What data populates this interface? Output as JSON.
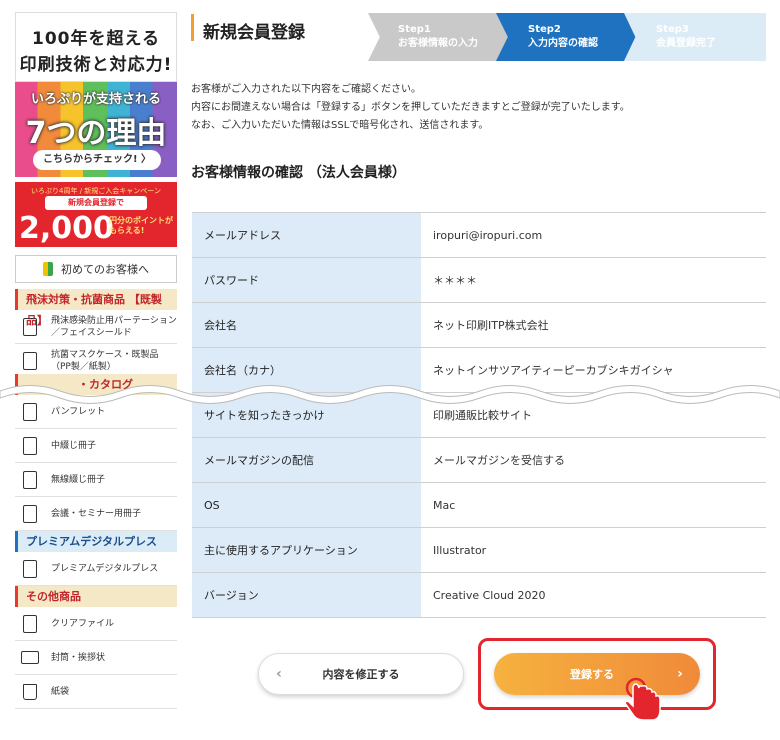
{
  "sidebar": {
    "banner1": {
      "line1": "100年を超える",
      "line2": "印刷技術と対応力!",
      "line3": "いろぷりが支持される",
      "line4": "7つの理由",
      "cta": "こちらからチェック! 〉"
    },
    "banner2": {
      "top": "いろぷり4周年 / 新規ご入会キャンペーン",
      "pill": "新規会員登録で",
      "amount": "2,000",
      "suffix": "円分のポイントがもらえる!"
    },
    "first_visit": "初めてのお客様へ",
    "sections": [
      {
        "heading": "飛沫対策・抗菌商品 【既製品】",
        "items": [
          "飛沫感染防止用パーテーション／フェイスシールド",
          "抗菌マスクケース・既製品（PP製／紙製）"
        ]
      },
      {
        "heading": "・カタログ",
        "items": [
          "パンフレット",
          "中綴じ冊子",
          "無線綴じ冊子",
          "会議・セミナー用冊子"
        ]
      },
      {
        "heading": "プレミアムデジタルプレス",
        "items": [
          "プレミアムデジタルプレス"
        ]
      },
      {
        "heading": "その他商品",
        "items": [
          "クリアファイル",
          "封筒・挨拶状",
          "紙袋"
        ]
      }
    ]
  },
  "page": {
    "title": "新規会員登録",
    "steps": [
      {
        "num": "Step1",
        "label": "お客様情報の入力"
      },
      {
        "num": "Step2",
        "label": "入力内容の確認"
      },
      {
        "num": "Step3",
        "label": "会員登録完了"
      }
    ],
    "intro": [
      "お客様がご入力された以下内容をご確認ください。",
      "内容にお間違えない場合は「登録する」ボタンを押していただきますとご登録が完了いたします。",
      "なお、ご入力いただいた情報はSSLで暗号化され、送信されます。"
    ],
    "section_title": "お客様情報の確認 （法人会員様）",
    "rows": [
      {
        "label": "メールアドレス",
        "value": "iropuri@iropuri.com"
      },
      {
        "label": "パスワード",
        "value": "＊＊＊＊"
      },
      {
        "label": "会社名",
        "value": "ネット印刷ITP株式会社"
      },
      {
        "label": "会社名（カナ）",
        "value": "ネットインサツアイティーピーカブシキガイシャ"
      },
      {
        "label": "サイトを知ったきっかけ",
        "value": "印刷通販比較サイト"
      },
      {
        "label": "メールマガジンの配信",
        "value": "メールマガジンを受信する"
      },
      {
        "label": "OS",
        "value": "Mac"
      },
      {
        "label": "主に使用するアプリケーション",
        "value": "Illustrator"
      },
      {
        "label": "バージョン",
        "value": "Creative Cloud 2020"
      }
    ],
    "back_button": "内容を修正する",
    "back_chevron": "‹",
    "submit_button": "登録する",
    "submit_chevron": "›"
  },
  "colors": {
    "accent_blue": "#1f72c0",
    "step_done": "#c9c9c9",
    "step_next": "#dcecf6",
    "table_header_bg": "#dcebf7",
    "submit_orange": "#f29a3a",
    "highlight_red": "#e3262d"
  },
  "icons": [
    "beginner-leaf-icon",
    "partition-icon",
    "mask-case-icon",
    "pamphlet-icon",
    "booklet-icon",
    "envelope-icon",
    "paper-bag-icon",
    "hand-pointer-icon"
  ]
}
